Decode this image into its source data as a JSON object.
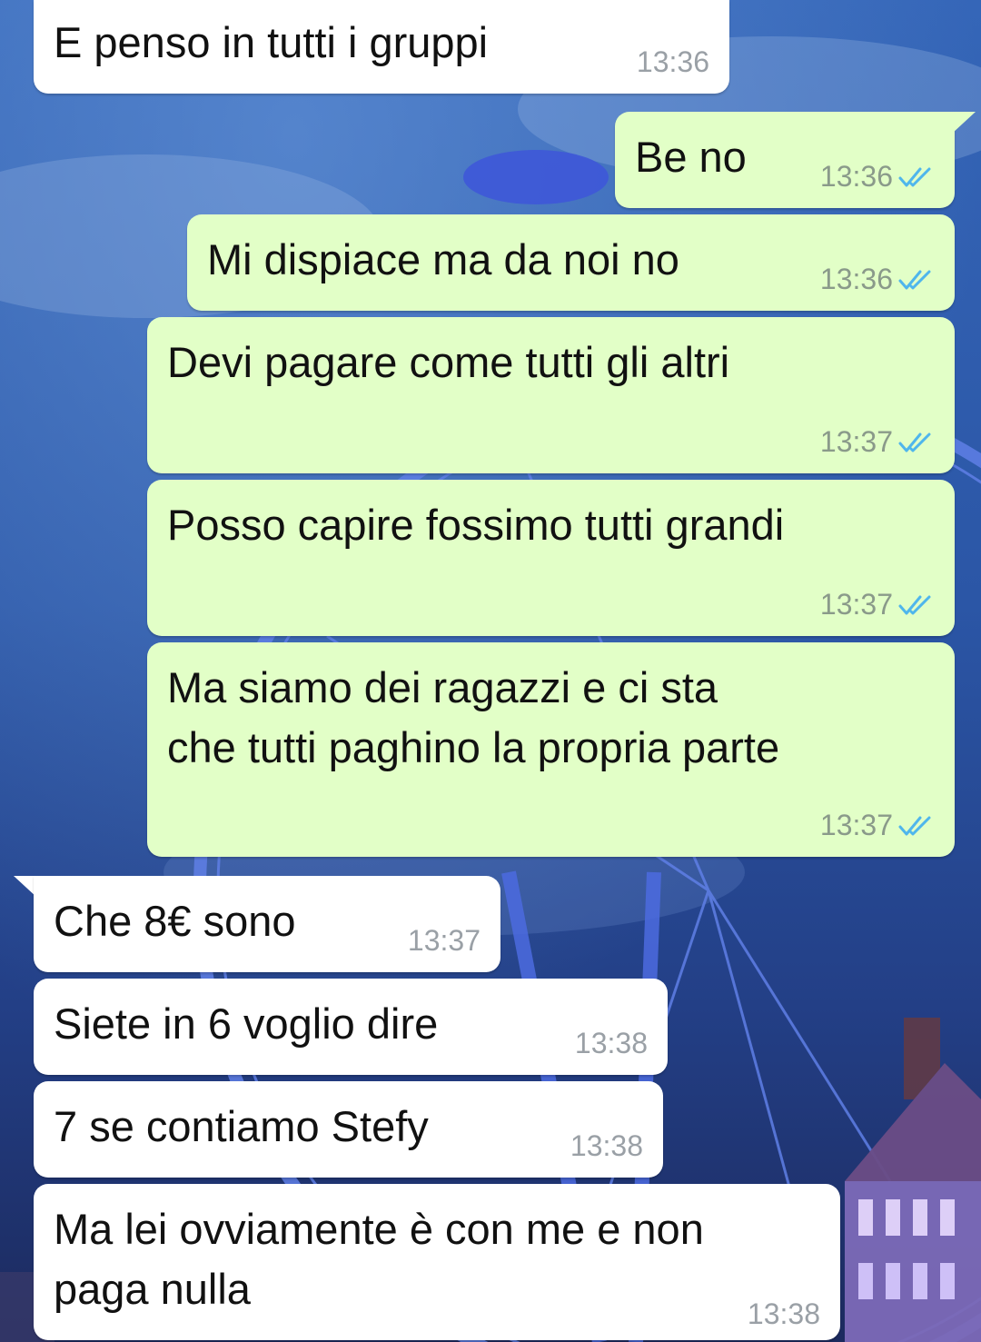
{
  "colors": {
    "incoming_bubble": "#ffffff",
    "outgoing_bubble": "#e2ffc7",
    "read_tick": "#4fb6ec",
    "timestamp": "#8a9a8a",
    "wallpaper_sky": "#1b3f8a"
  },
  "messages": [
    {
      "direction": "incoming",
      "text": "E penso in tutti i gruppi",
      "time": "13:36"
    },
    {
      "direction": "outgoing",
      "text": "Be no",
      "time": "13:36",
      "status_icon": "double-check-icon"
    },
    {
      "direction": "outgoing",
      "text": "Mi dispiace ma da noi no",
      "time": "13:36",
      "status_icon": "double-check-icon"
    },
    {
      "direction": "outgoing",
      "text": "Devi pagare come tutti gli altri",
      "time": "13:37",
      "status_icon": "double-check-icon"
    },
    {
      "direction": "outgoing",
      "text": "Posso capire fossimo tutti grandi",
      "time": "13:37",
      "status_icon": "double-check-icon"
    },
    {
      "direction": "outgoing",
      "text": "Ma siamo dei ragazzi e ci sta\nche tutti paghino la propria parte",
      "time": "13:37",
      "status_icon": "double-check-icon"
    },
    {
      "direction": "incoming",
      "text": "Che 8€ sono",
      "time": "13:37"
    },
    {
      "direction": "incoming",
      "text": "Siete in 6 voglio dire",
      "time": "13:38"
    },
    {
      "direction": "incoming",
      "text": "7 se contiamo Stefy",
      "time": "13:38"
    },
    {
      "direction": "incoming",
      "text": "Ma lei ovviamente è con me e non\npaga nulla",
      "time": "13:38"
    }
  ]
}
